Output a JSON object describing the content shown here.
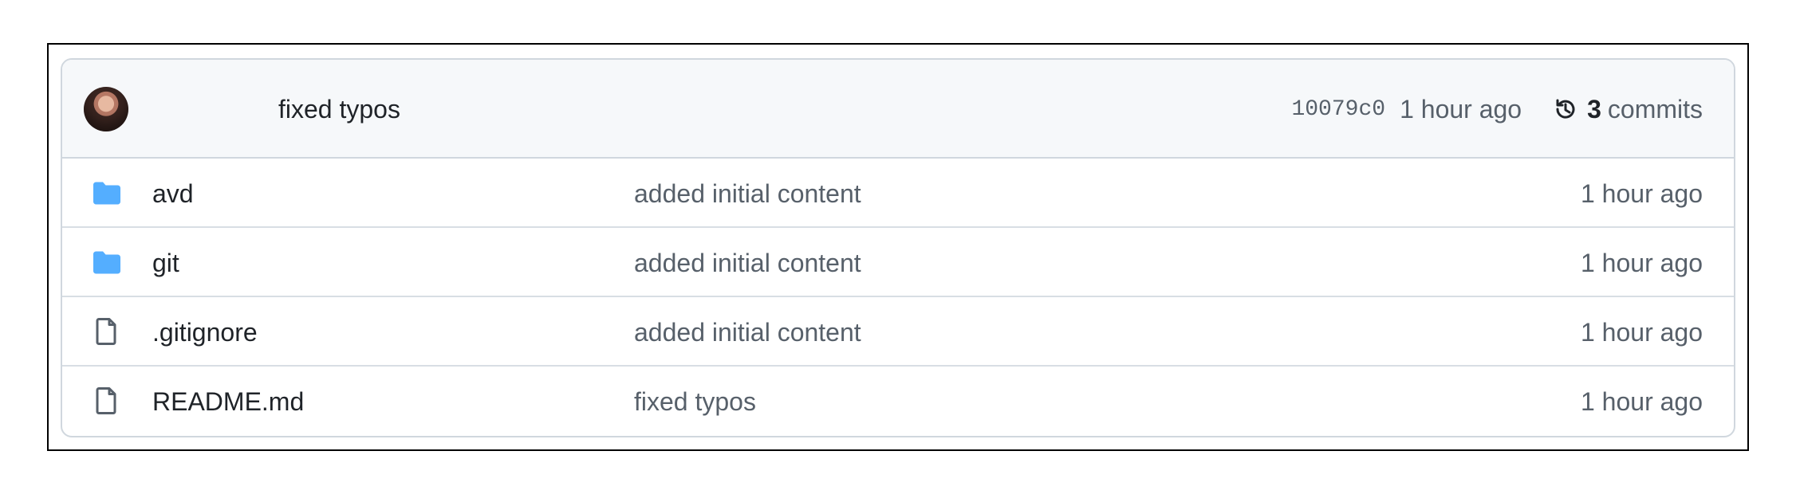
{
  "commit": {
    "message": "fixed typos",
    "sha": "10079c0",
    "time": "1 hour ago",
    "count": "3",
    "count_label": "commits"
  },
  "files": [
    {
      "name": "avd",
      "type": "folder",
      "icon": "folder-icon",
      "message": "added initial content",
      "age": "1 hour ago"
    },
    {
      "name": "git",
      "type": "folder",
      "icon": "folder-icon",
      "message": "added initial content",
      "age": "1 hour ago"
    },
    {
      "name": ".gitignore",
      "type": "file",
      "icon": "file-icon",
      "message": "added initial content",
      "age": "1 hour ago"
    },
    {
      "name": "README.md",
      "type": "file",
      "icon": "file-icon",
      "message": "fixed typos",
      "age": "1 hour ago"
    }
  ],
  "colors": {
    "folder": "#54aeff",
    "file_icon": "#57606a",
    "border": "#d0d7de",
    "muted_text": "#57606a"
  }
}
